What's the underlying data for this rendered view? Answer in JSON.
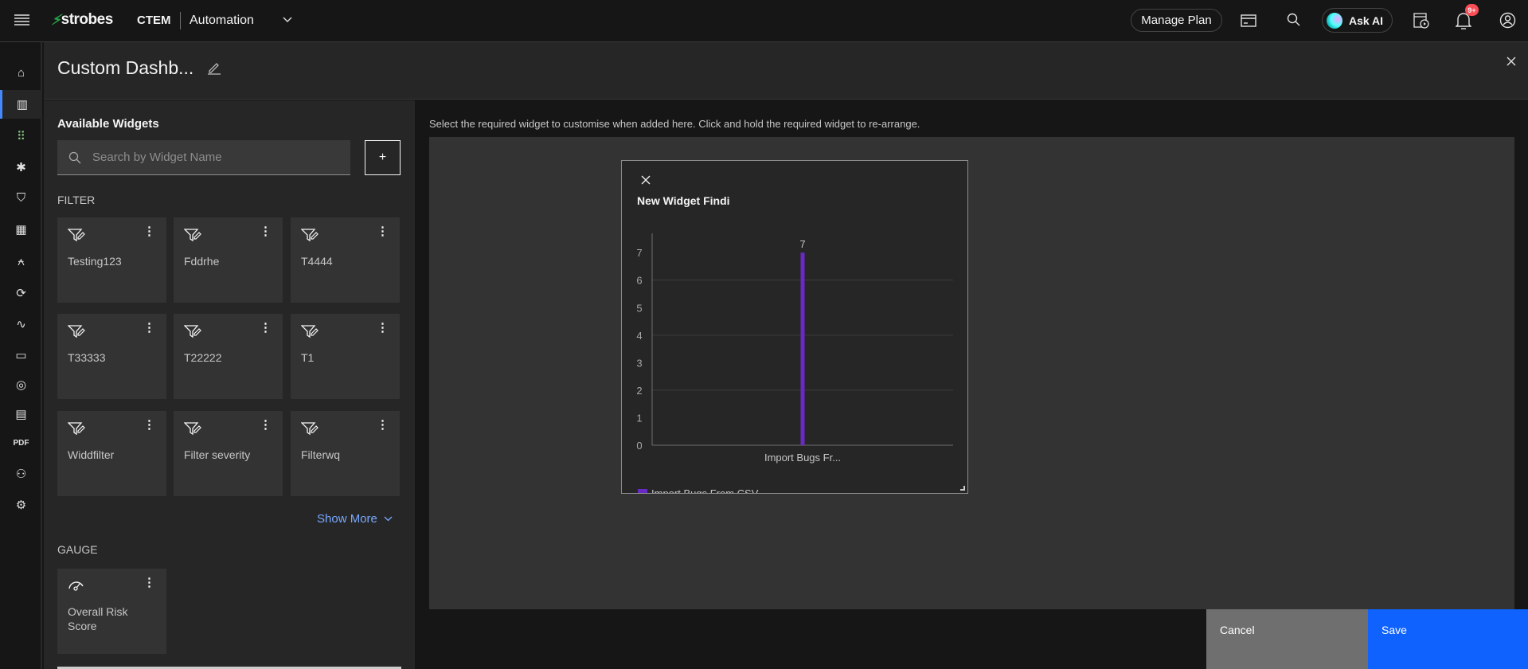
{
  "topbar": {
    "brand": "strobes",
    "product": "CTEM",
    "workspace": "Automation",
    "manage_plan": "Manage Plan",
    "ask_ai": "Ask AI",
    "notifications_badge": "9+"
  },
  "header": {
    "title": "Custom Dashb..."
  },
  "left_panel": {
    "title": "Available Widgets",
    "search_placeholder": "Search by Widget Name",
    "add_label": "+",
    "filter_section": "FILTER",
    "filter_widgets": [
      "Testing123",
      "Fddrhe",
      "T4444",
      "T33333",
      "T22222",
      "T1",
      "Widdfilter",
      "Filter severity",
      "Filterwq"
    ],
    "show_more": "Show More",
    "gauge_section": "GAUGE",
    "gauge_widgets": [
      "Overall Risk Score"
    ]
  },
  "canvas": {
    "instruction": "Select the required widget to customise when added here. Click and hold the required widget to re-arrange."
  },
  "widget": {
    "title": "New Widget Findi",
    "legend": "Import Bugs From CSV"
  },
  "chart_data": {
    "type": "bar",
    "title": "New Widget Findi",
    "categories": [
      "Import Bugs Fr..."
    ],
    "series": [
      {
        "name": "Import Bugs From CSV",
        "values": [
          7
        ],
        "color": "#6929c4"
      }
    ],
    "yticks": [
      0,
      1,
      2,
      3,
      4,
      5,
      6,
      7
    ],
    "ylim": [
      0,
      7.7
    ],
    "gridlines": [
      2,
      4,
      6
    ],
    "data_labels": [
      "7"
    ],
    "legend": "bottom-left"
  },
  "actions": {
    "cancel": "Cancel",
    "save": "Save"
  },
  "colors": {
    "accent": "#0f62fe",
    "active": "#4589ff",
    "bar": "#6929c4",
    "badge": "#fa4d56",
    "link": "#78a9ff"
  }
}
